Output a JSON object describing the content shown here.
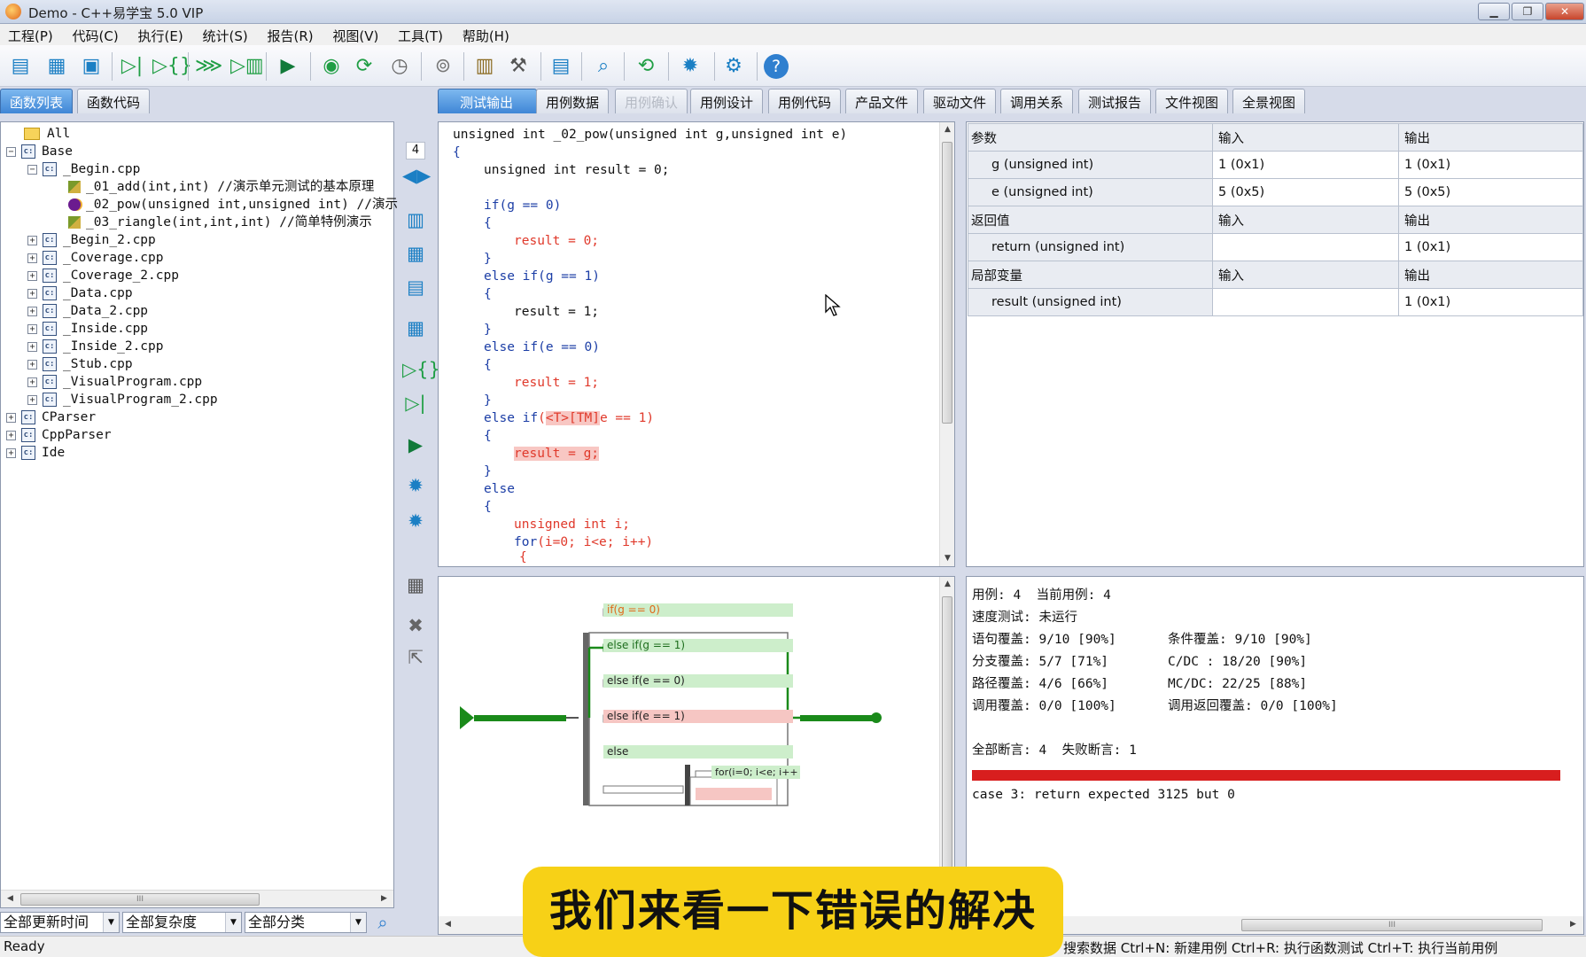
{
  "window": {
    "title": "Demo - C++易学宝 5.0 VIP"
  },
  "menu": [
    "工程(P)",
    "代码(C)",
    "执行(E)",
    "统计(S)",
    "报告(R)",
    "视图(V)",
    "工具(T)",
    "帮助(H)"
  ],
  "left_tabs": [
    "函数列表",
    "函数代码"
  ],
  "main_tabs": [
    "测试输出",
    "用例数据",
    "用例确认",
    "用例设计",
    "用例代码",
    "产品文件",
    "驱动文件",
    "调用关系",
    "测试报告",
    "文件视图",
    "全景视图"
  ],
  "tree": {
    "all": "All",
    "base": "Base",
    "begin_cpp": "_Begin.cpp",
    "fn1": "_01_add(int,int) //演示单元测试的基本原理",
    "fn2": "_02_pow(unsigned int,unsigned int) //演示",
    "fn3": "_03_riangle(int,int,int) //简单特例演示",
    "files": [
      "_Begin_2.cpp",
      "_Coverage.cpp",
      "_Coverage_2.cpp",
      "_Data.cpp",
      "_Data_2.cpp",
      "_Inside.cpp",
      "_Inside_2.cpp",
      "_Stub.cpp",
      "_VisualProgram.cpp",
      "_VisualProgram_2.cpp"
    ],
    "roots": [
      "CParser",
      "CppParser",
      "Ide"
    ]
  },
  "side_counter": "4",
  "code": {
    "l1": "unsigned int _02_pow(unsigned int g,unsigned int e)",
    "l2": "{",
    "l3": "unsigned int result = 0;",
    "l4": "if(g == 0)",
    "l5": "{",
    "l6": "result = 0;",
    "l7": "}",
    "l8_kw": "else if",
    "l8": "(g == 1)",
    "l9": "{",
    "l10": "result = 1;",
    "l11": "}",
    "l12_kw": "else if",
    "l12": "(e == 0)",
    "l13": "{",
    "l14": "result = 1;",
    "l15": "}",
    "l16_kw": "else if",
    "l16_a": "(",
    "l16_t": "<T>",
    "l16_tm": "[TM]",
    "l16_b": "e == 1)",
    "l17": "{",
    "l18": "result = g;",
    "l19": "}",
    "l20": "else",
    "l21": "{",
    "l22": "unsigned int i;",
    "l23_kw": "for",
    "l23": "(i=0; i<e; i++)",
    "l24": "{"
  },
  "params": {
    "header": [
      "参数",
      "输入",
      "输出"
    ],
    "rows": [
      {
        "name": "g (unsigned int)",
        "in": "1 (0x1)",
        "out": "1 (0x1)"
      },
      {
        "name": "e (unsigned int)",
        "in": "5 (0x5)",
        "out": "5 (0x5)"
      }
    ],
    "ret_header": [
      "返回值",
      "输入",
      "输出"
    ],
    "ret": {
      "name": "return (unsigned int)",
      "in": "",
      "out": "1 (0x1)"
    },
    "local_header": [
      "局部变量",
      "输入",
      "输出"
    ],
    "local": {
      "name": "result (unsigned int)",
      "in": "",
      "out": "1 (0x1)"
    }
  },
  "flow": {
    "labels": [
      "if(g == 0)",
      "else if(g == 1)",
      "else if(e == 0)",
      "else if(e == 1)",
      "else",
      "for(i=0; i<e; i++"
    ]
  },
  "coverage": {
    "cases": "用例: 4  当前用例: 4",
    "speed": "速度测试: 未运行",
    "stmt": "语句覆盖: 9/10 [90%]",
    "cond": "条件覆盖: 9/10 [90%]",
    "branch": "分支覆盖: 5/7 [71%]",
    "cdc": "C/DC : 18/20 [90%]",
    "path": "路径覆盖: 4/6 [66%]",
    "mcdc": "MC/DC: 22/25 [88%]",
    "call": "调用覆盖: 0/0 [100%]",
    "callret": "调用返回覆盖: 0/0 [100%]",
    "asserts": "全部断言: 4  失败断言: 1",
    "error": "case 3: return expected 3125 but 0",
    "bar_color": "#d81e1e",
    "fail_ratio": 1
  },
  "filters": [
    "全部更新时间",
    "全部复杂度",
    "全部分类"
  ],
  "status": {
    "ready": "Ready",
    "hints": "搜索数据  Ctrl+N: 新建用例 Ctrl+R: 执行函数测试  Ctrl+T: 执行当前用例"
  },
  "subtitle": "我们来看一下错误的解决"
}
